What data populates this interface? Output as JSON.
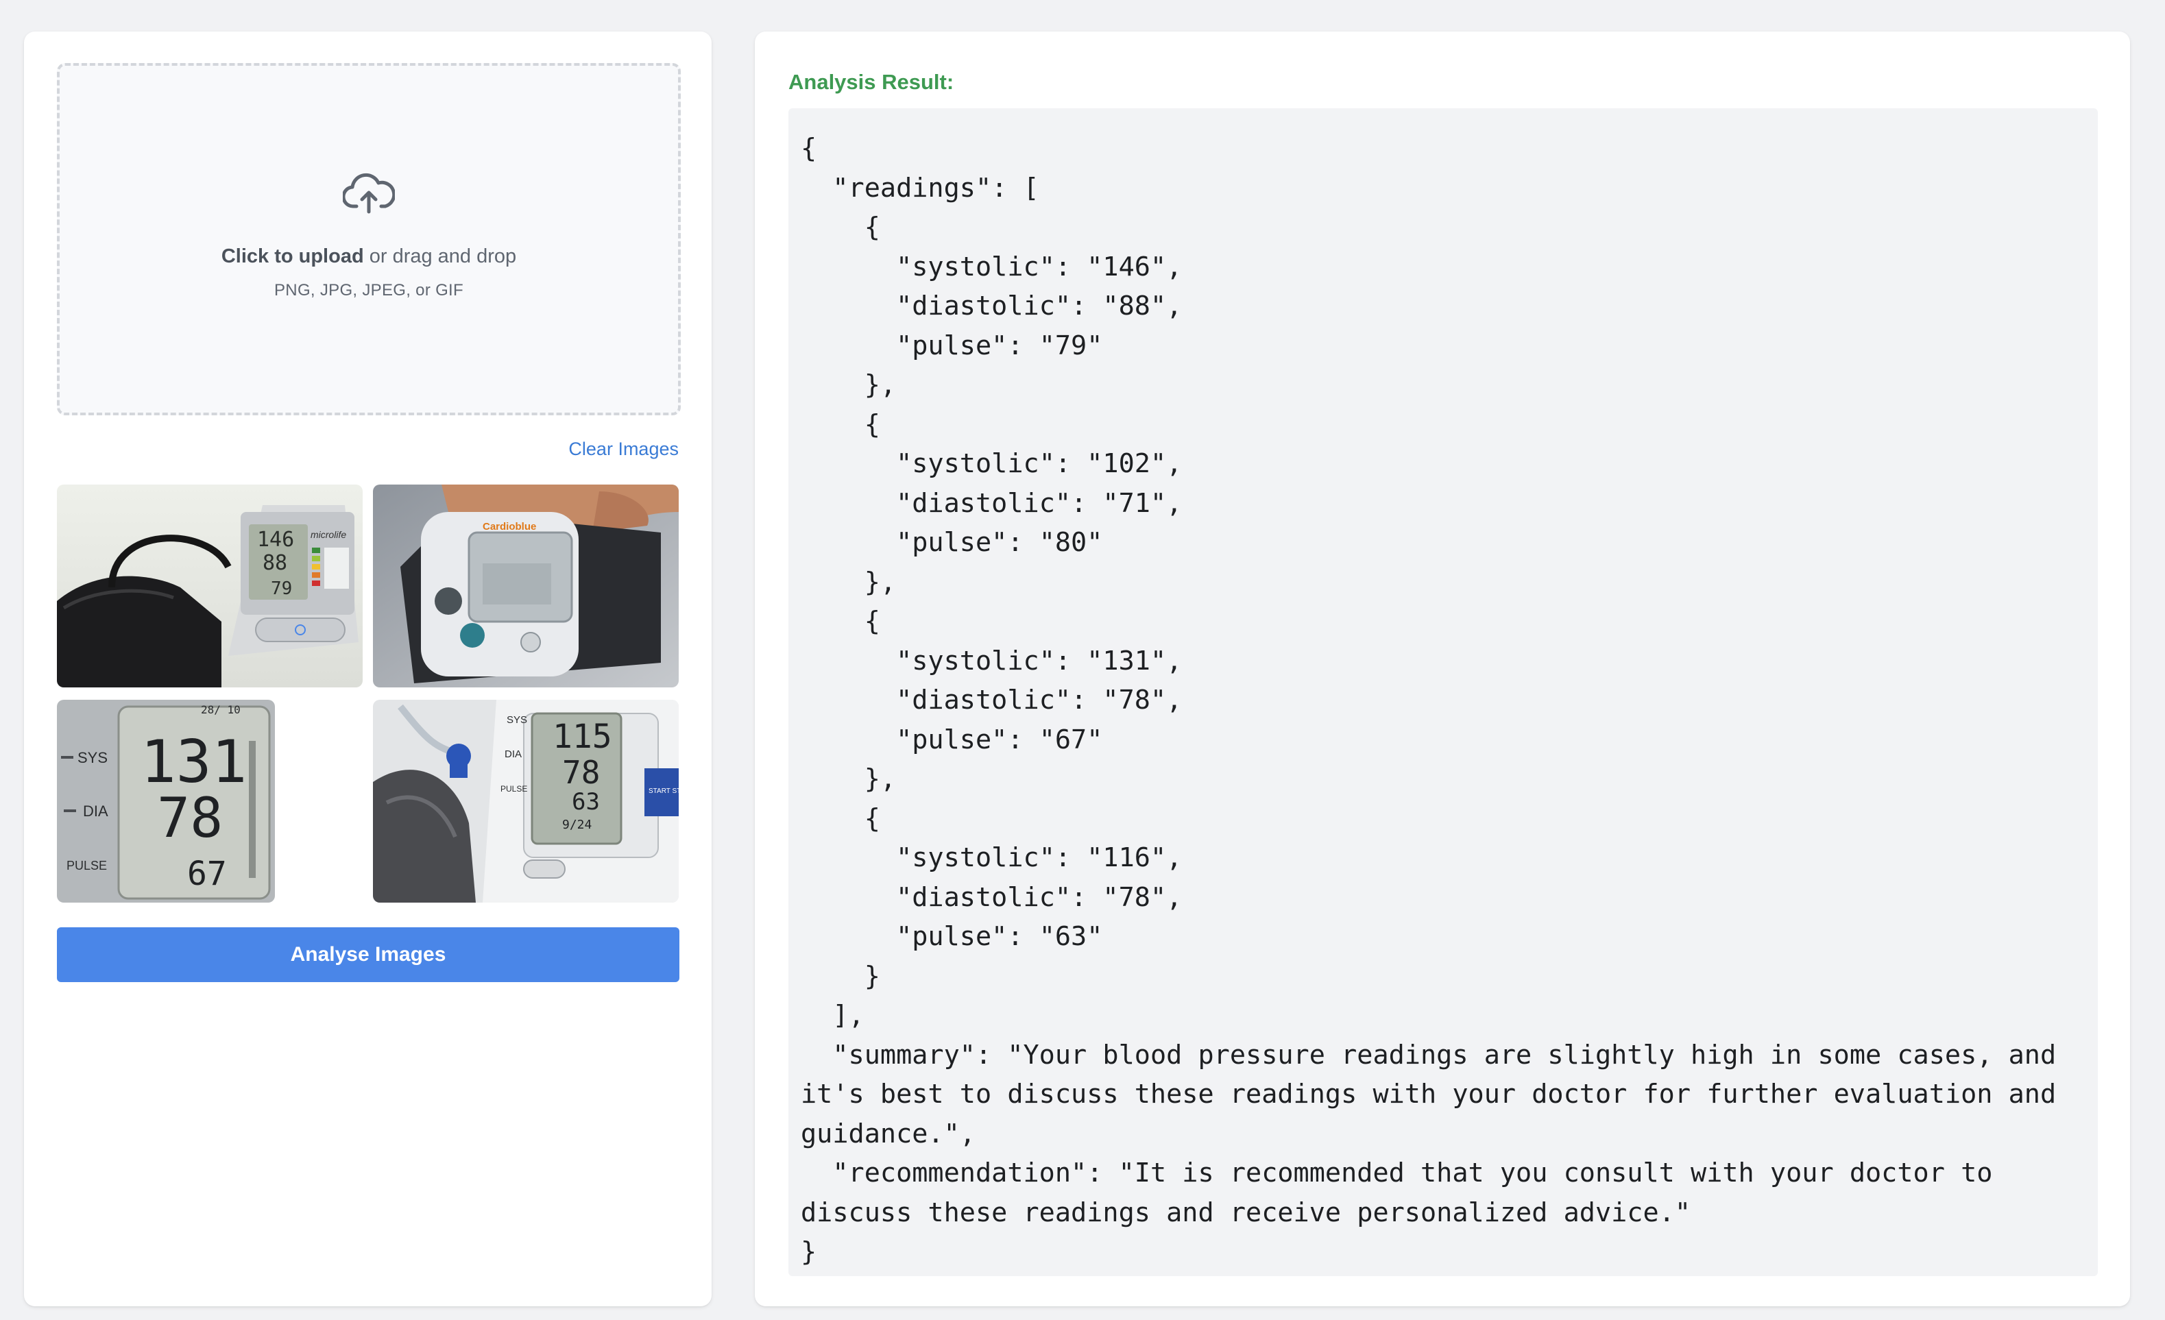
{
  "upload": {
    "icon": "cloud-upload-icon",
    "click_text": "Click to upload",
    "drag_text": " or drag and drop",
    "formats": "PNG, JPG, JPEG, or GIF"
  },
  "clear_label": "Clear Images",
  "thumbnails": [
    {
      "icon": "blood-pressure-monitor-image",
      "display": [
        "146",
        "88",
        "79"
      ],
      "brand": "microlife"
    },
    {
      "icon": "wrist-monitor-image",
      "brand": "Cardioblue"
    },
    {
      "icon": "monitor-display-closeup-image",
      "labels": [
        "SYS",
        "DIA",
        "PULSE"
      ],
      "display": [
        "131",
        "78",
        "67"
      ],
      "date": "28/ 10"
    },
    {
      "icon": "upper-arm-monitor-image",
      "labels": [
        "SYS",
        "DIA",
        "PULSE"
      ],
      "display": [
        "115",
        "78",
        "63"
      ],
      "date": "9/24",
      "button": "START STOP"
    }
  ],
  "analyse_label": "Analyse Images",
  "result": {
    "title": "Analysis Result:",
    "text": "{\n  \"readings\": [\n    {\n      \"systolic\": \"146\",\n      \"diastolic\": \"88\",\n      \"pulse\": \"79\"\n    },\n    {\n      \"systolic\": \"102\",\n      \"diastolic\": \"71\",\n      \"pulse\": \"80\"\n    },\n    {\n      \"systolic\": \"131\",\n      \"diastolic\": \"78\",\n      \"pulse\": \"67\"\n    },\n    {\n      \"systolic\": \"116\",\n      \"diastolic\": \"78\",\n      \"pulse\": \"63\"\n    }\n  ],\n  \"summary\": \"Your blood pressure readings are slightly high in some cases, and it's best to discuss these readings with your doctor for further evaluation and guidance.\",\n  \"recommendation\": \"It is recommended that you consult with your doctor to discuss these readings and receive personalized advice.\"\n}"
  },
  "colors": {
    "accent": "#4a86e8",
    "link": "#3a7bd5",
    "result_title": "#3e9a52",
    "background": "#f1f2f4"
  }
}
